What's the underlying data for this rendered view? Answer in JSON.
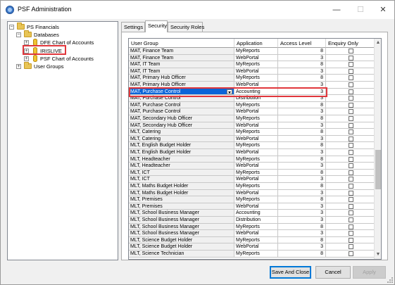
{
  "window": {
    "title": "PSF Administration",
    "minimize_glyph": "—",
    "maximize_glyph": "☐",
    "close_glyph": "✕"
  },
  "tree": {
    "root": "PS Financials",
    "databases": "Databases",
    "db_items": [
      "DFE Chart of Accounts",
      "IRISLIVE",
      "PSF Chart of Accounts"
    ],
    "user_groups": "User Groups",
    "selected_item": "IRISLIVE"
  },
  "tabs": [
    {
      "label": "Settings",
      "active": false
    },
    {
      "label": "Security",
      "active": true
    },
    {
      "label": "Security Roles",
      "active": false
    }
  ],
  "grid": {
    "columns": [
      "User Group",
      "Application",
      "Access Level",
      "Enquiry Only"
    ],
    "rows": [
      {
        "group": "MAT, Finance Team",
        "app": "MyReports",
        "level": "8",
        "enquiry": false
      },
      {
        "group": "MAT, Finance Team",
        "app": "WebPortal",
        "level": "3",
        "enquiry": false
      },
      {
        "group": "MAT, IT Team",
        "app": "MyReports",
        "level": "8",
        "enquiry": false
      },
      {
        "group": "MAT, IT Team",
        "app": "WebPortal",
        "level": "3",
        "enquiry": false
      },
      {
        "group": "MAT, Primary Hub Officer",
        "app": "MyReports",
        "level": "8",
        "enquiry": false
      },
      {
        "group": "MAT, Primary Hub Officer",
        "app": "WebPortal",
        "level": "3",
        "enquiry": false
      },
      {
        "group": "MAT, Purchase Control",
        "app": "Accounting",
        "level": "3",
        "enquiry": false,
        "selected": true
      },
      {
        "group": "MAT, Purchase Control",
        "app": "Distribution",
        "level": "3",
        "enquiry": false
      },
      {
        "group": "MAT, Purchase Control",
        "app": "MyReports",
        "level": "8",
        "enquiry": false
      },
      {
        "group": "MAT, Purchase Control",
        "app": "WebPortal",
        "level": "3",
        "enquiry": false
      },
      {
        "group": "MAT, Secondary Hub Officer",
        "app": "MyReports",
        "level": "8",
        "enquiry": false
      },
      {
        "group": "MAT, Secondary Hub Officer",
        "app": "WebPortal",
        "level": "3",
        "enquiry": false
      },
      {
        "group": "MLT, Catering",
        "app": "MyReports",
        "level": "8",
        "enquiry": false
      },
      {
        "group": "MLT, Catering",
        "app": "WebPortal",
        "level": "3",
        "enquiry": false
      },
      {
        "group": "MLT, English Budget Holder",
        "app": "MyReports",
        "level": "8",
        "enquiry": false
      },
      {
        "group": "MLT, English Budget Holder",
        "app": "WebPortal",
        "level": "3",
        "enquiry": false
      },
      {
        "group": "MLT, Headteacher",
        "app": "MyReports",
        "level": "8",
        "enquiry": false
      },
      {
        "group": "MLT, Headteacher",
        "app": "WebPortal",
        "level": "3",
        "enquiry": false
      },
      {
        "group": "MLT, ICT",
        "app": "MyReports",
        "level": "8",
        "enquiry": false
      },
      {
        "group": "MLT, ICT",
        "app": "WebPortal",
        "level": "3",
        "enquiry": false
      },
      {
        "group": "MLT, Maths Budget Holder",
        "app": "MyReports",
        "level": "8",
        "enquiry": false
      },
      {
        "group": "MLT, Maths Budget Holder",
        "app": "WebPortal",
        "level": "3",
        "enquiry": false
      },
      {
        "group": "MLT, Premises",
        "app": "MyReports",
        "level": "8",
        "enquiry": false
      },
      {
        "group": "MLT, Premises",
        "app": "WebPortal",
        "level": "3",
        "enquiry": false
      },
      {
        "group": "MLT, School Business Manager",
        "app": "Accounting",
        "level": "3",
        "enquiry": false
      },
      {
        "group": "MLT, School Business Manager",
        "app": "Distribution",
        "level": "3",
        "enquiry": false
      },
      {
        "group": "MLT, School Business Manager",
        "app": "MyReports",
        "level": "8",
        "enquiry": false
      },
      {
        "group": "MLT, School Business Manager",
        "app": "WebPortal",
        "level": "3",
        "enquiry": false
      },
      {
        "group": "MLT, Science Budget Holder",
        "app": "MyReports",
        "level": "8",
        "enquiry": false
      },
      {
        "group": "MLT, Science Budget Holder",
        "app": "WebPortal",
        "level": "3",
        "enquiry": false
      },
      {
        "group": "MLT, Science Technician",
        "app": "MyReports",
        "level": "8",
        "enquiry": false
      }
    ]
  },
  "buttons": {
    "save_and_close": "Save And Close",
    "cancel": "Cancel",
    "apply": "Apply"
  },
  "colors": {
    "selection": "#0a64d8",
    "highlight_box": "#e0373c"
  }
}
